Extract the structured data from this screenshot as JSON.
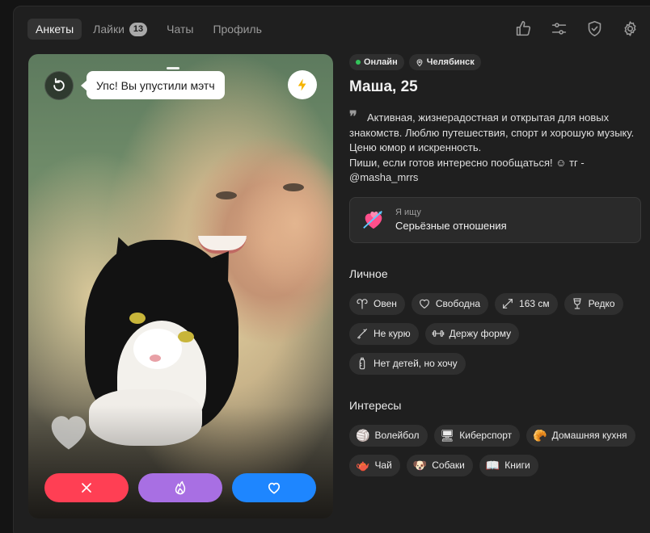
{
  "nav": {
    "tabs": [
      {
        "label": "Анкеты",
        "active": true
      },
      {
        "label": "Лайки",
        "badge": "13"
      },
      {
        "label": "Чаты"
      },
      {
        "label": "Профиль"
      }
    ],
    "icons": [
      "thumbs-up-icon",
      "sliders-icon",
      "shield-check-icon",
      "gear-icon"
    ]
  },
  "card": {
    "toast": "Упс! Вы упустили мэтч",
    "colors": {
      "dislike": "#ff3f54",
      "super": "#a86fe3",
      "like": "#1e86ff"
    }
  },
  "profile": {
    "status": "Онлайн",
    "city": "Челябинск",
    "name": "Маша, 25",
    "bio_lines": [
      "Активная, жизнерадостная и открытая для новых",
      "знакомств. Люблю путешествия, спорт и хорошую музыку.",
      "Ценю юмор и искренность.",
      "Пиши, если готов интересно пообщаться! ☺ тг -",
      "@masha_mrrs"
    ],
    "looking_label": "Я ищу",
    "looking_value": "Серьёзные отношения"
  },
  "personal": {
    "title": "Личное",
    "items": [
      "Овен",
      "Свободна",
      "163 см",
      "Редко",
      "Не курю",
      "Держу форму",
      "Нет детей, но хочу"
    ]
  },
  "interests": {
    "title": "Интересы",
    "items": [
      "Волейбол",
      "Киберспорт",
      "Домашняя кухня",
      "Чай",
      "Собаки",
      "Книги"
    ]
  }
}
